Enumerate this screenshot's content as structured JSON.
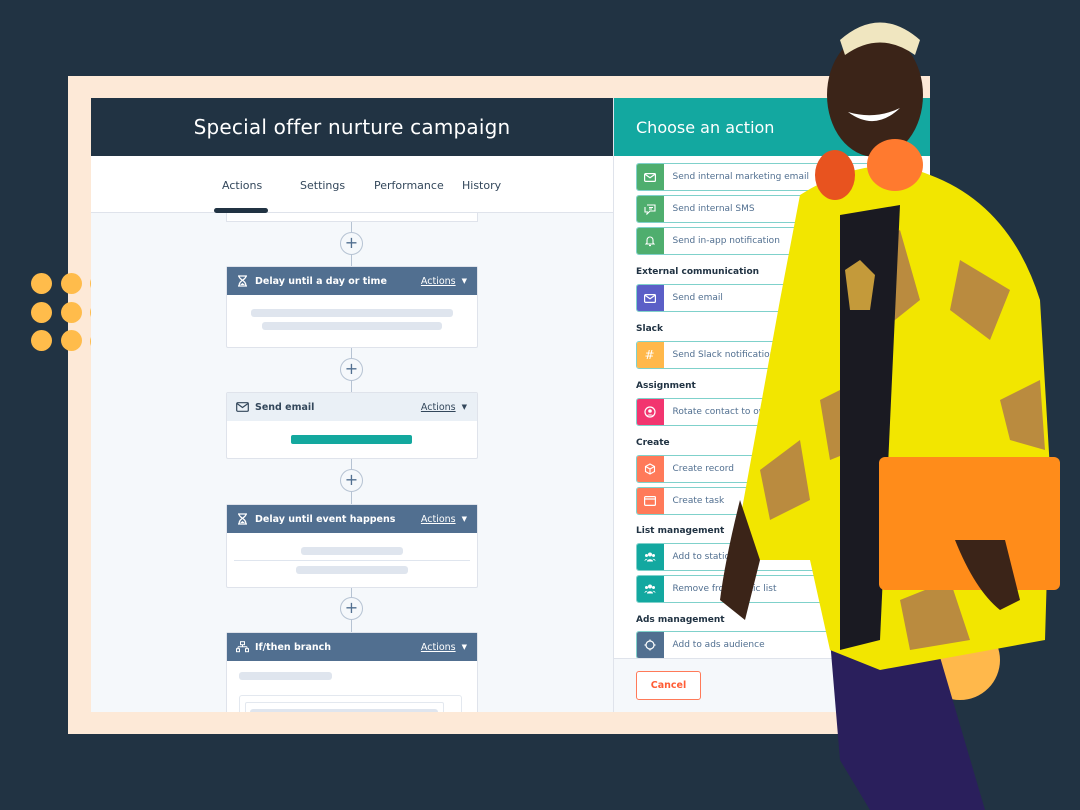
{
  "workflow": {
    "title": "Special offer nurture campaign",
    "tabs": [
      {
        "label": "Actions",
        "active": true
      },
      {
        "label": "Settings",
        "active": false
      },
      {
        "label": "Performance",
        "active": false
      },
      {
        "label": "History",
        "active": false
      }
    ],
    "cards": [
      {
        "icon": "hourglass-icon",
        "title": "Delay until a day or time",
        "actions_label": "Actions"
      },
      {
        "icon": "envelope-icon",
        "title": "Send email",
        "actions_label": "Actions"
      },
      {
        "icon": "hourglass-icon",
        "title": "Delay until event happens",
        "actions_label": "Actions"
      },
      {
        "icon": "branch-icon",
        "title": "If/then branch",
        "actions_label": "Actions"
      }
    ],
    "add_step_symbol": "+"
  },
  "panel": {
    "title": "Choose an action",
    "sections": [
      {
        "heading": "",
        "items": [
          {
            "label": "Send internal marketing email",
            "icon": "envelope-icon",
            "color": "#4fae6e"
          },
          {
            "label": "Send internal SMS",
            "icon": "chat-icon",
            "color": "#4fae6e"
          },
          {
            "label": "Send in-app notification",
            "icon": "bell-icon",
            "color": "#4fae6e"
          }
        ]
      },
      {
        "heading": "External communication",
        "items": [
          {
            "label": "Send email",
            "icon": "envelope-icon",
            "color": "#5b5fc7"
          }
        ]
      },
      {
        "heading": "Slack",
        "items": [
          {
            "label": "Send Slack notification",
            "icon": "slack-icon",
            "color": "#ffb84b"
          }
        ]
      },
      {
        "heading": "Assignment",
        "items": [
          {
            "label": "Rotate contact to owner",
            "icon": "rotate-user-icon",
            "color": "#f2356f"
          }
        ]
      },
      {
        "heading": "Create",
        "items": [
          {
            "label": "Create record",
            "icon": "cube-icon",
            "color": "#ff7a59"
          },
          {
            "label": "Create task",
            "icon": "task-icon",
            "color": "#ff7a59"
          }
        ]
      },
      {
        "heading": "List management",
        "items": [
          {
            "label": "Add to static list",
            "icon": "people-icon",
            "color": "#13a8a0"
          },
          {
            "label": "Remove from static list",
            "icon": "people-icon",
            "color": "#13a8a0"
          }
        ]
      },
      {
        "heading": "Ads management",
        "items": [
          {
            "label": "Add to ads audience",
            "icon": "target-icon",
            "color": "#516f90"
          }
        ]
      }
    ],
    "cancel_label": "Cancel"
  }
}
